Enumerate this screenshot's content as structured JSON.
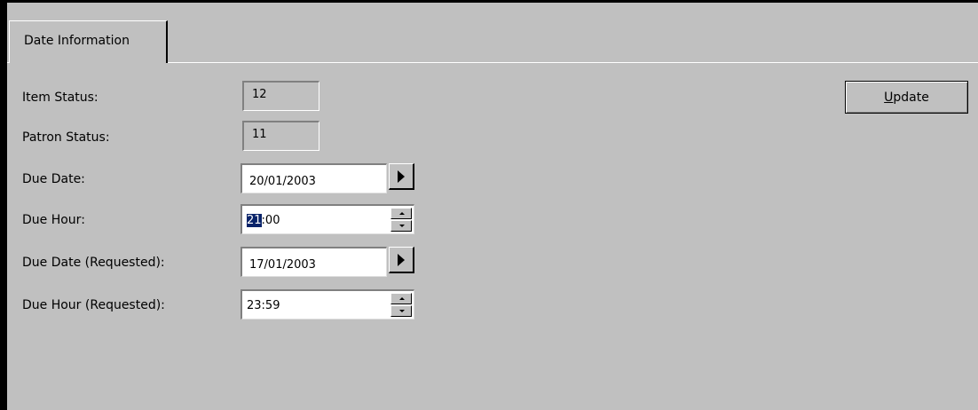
{
  "tab": {
    "label": "Date Information"
  },
  "fields": {
    "item_status": {
      "label": "Item Status:",
      "value": "12"
    },
    "patron_status": {
      "label": "Patron Status:",
      "value": "11"
    },
    "due_date": {
      "label": "Due Date:",
      "value": "20/01/2003"
    },
    "due_hour": {
      "label": "Due Hour:",
      "value_selected": "21",
      "value_rest": ":00"
    },
    "due_date_requested": {
      "label": "Due Date (Requested):",
      "value": "17/01/2003"
    },
    "due_hour_requested": {
      "label": "Due Hour (Requested):",
      "value": "23:59"
    }
  },
  "buttons": {
    "update_mnemonic": "U",
    "update_rest": "pdate"
  },
  "icons": {
    "date_picker": "right-arrow-icon",
    "spin_up": "spin-up-icon",
    "spin_down": "spin-down-icon"
  },
  "colors": {
    "background": "#c0c0c0",
    "selection": "#0a246a"
  }
}
